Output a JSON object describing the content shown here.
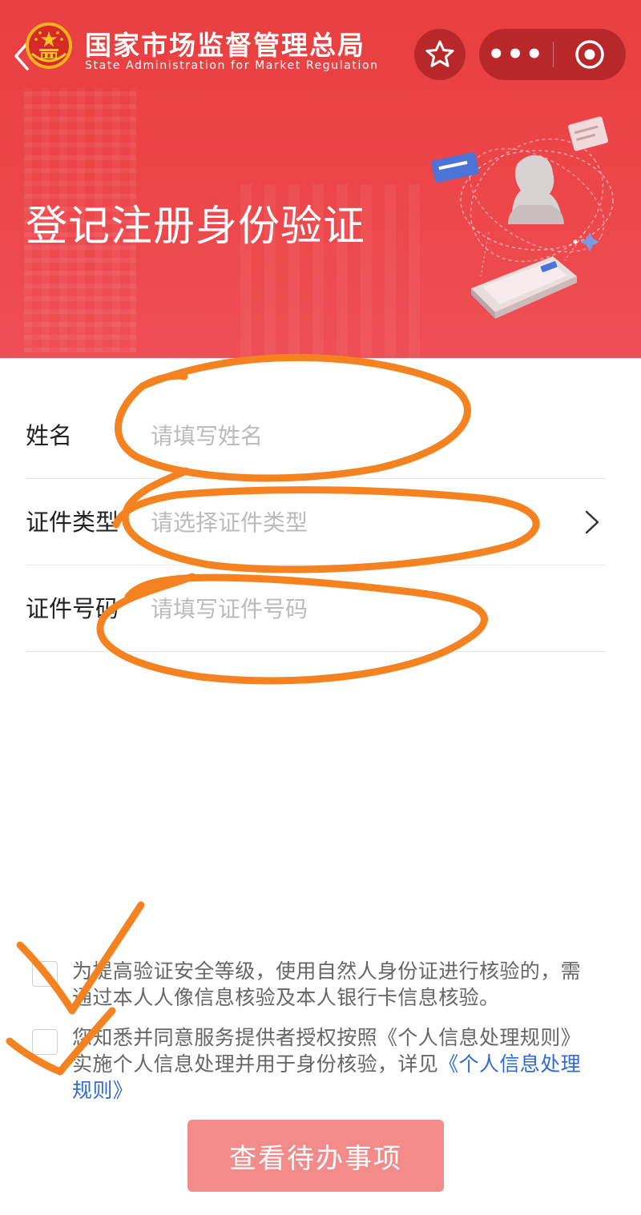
{
  "header": {
    "agency_name_cn": "国家市场监督管理总局",
    "agency_name_en": "State Administration for Market Regulation",
    "page_title": "登记注册身份验证",
    "back_icon": "chevron-left-icon",
    "capsule_more_label": "•••",
    "bg_color": "#e83f40"
  },
  "form": {
    "name": {
      "label": "姓名",
      "placeholder": "请填写姓名"
    },
    "id_type": {
      "label": "证件类型",
      "placeholder": "请选择证件类型"
    },
    "id_number": {
      "label": "证件号码",
      "placeholder": "请填写证件号码"
    }
  },
  "agreements": {
    "item1": "为提高验证安全等级，使用自然人身份证进行核验的，需通过本人人像信息核验及本人银行卡信息核验。",
    "item2_text": "您知悉并同意服务提供者授权按照《个人信息处理规则》实施个人信息处理并用于身份核验，详见",
    "item2_link": "《个人信息处理规则》",
    "link_color": "#2f6bd8"
  },
  "submit": {
    "label": "查看待办事项",
    "color": "#f48b8b"
  },
  "annotation_color": "#f58220"
}
